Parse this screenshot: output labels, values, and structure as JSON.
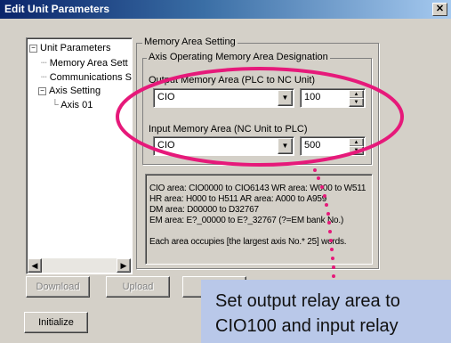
{
  "window": {
    "title": "Edit Unit Parameters",
    "close_glyph": "✕"
  },
  "tree": {
    "items": [
      {
        "label": "Unit Parameters",
        "expander": "−"
      },
      {
        "label": "Memory Area Sett"
      },
      {
        "label": "Communications S"
      },
      {
        "label": "Axis Setting",
        "expander": "−"
      },
      {
        "label": "Axis 01"
      }
    ]
  },
  "memory_group": {
    "title": "Memory Area Setting",
    "axis_group_title": "Axis Operating Memory Area Designation",
    "output": {
      "label": "Output Memory Area (PLC to NC Unit)",
      "area": "CIO",
      "address": "100"
    },
    "input": {
      "label": "Input Memory Area (NC Unit to PLC)",
      "area": "CIO",
      "address": "500"
    }
  },
  "info": {
    "lines": [
      "CIO area: CIO0000 to CIO6143   WR area: W000 to W511",
      "HR area: H000 to H511          AR area: A000 to A959",
      "DM area: D00000 to D32767",
      "EM area: E?_00000 to E?_32767 (?=EM bank No.)",
      "",
      "Each area occupies [the largest axis No.* 25] words."
    ]
  },
  "buttons": {
    "download": "Download",
    "upload": "Upload",
    "initialize": "Initialize"
  },
  "callout": {
    "line1": "Set output relay area to",
    "line2": "CIO100 and input relay"
  },
  "colors": {
    "highlight": "#e6197a",
    "callout_bg": "#b9c8e9"
  }
}
